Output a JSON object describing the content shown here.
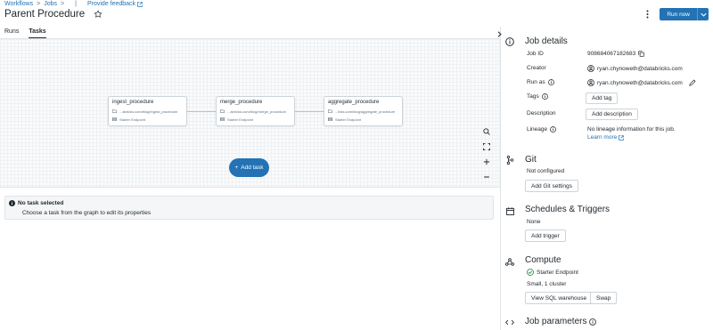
{
  "breadcrumb": {
    "workflows": "Workflows",
    "jobs": "Jobs",
    "separator": ">",
    "divider": "|",
    "feedback": "Provide feedback"
  },
  "header": {
    "title": "Parent Procedure",
    "run_now": "Run now"
  },
  "tabs": [
    {
      "label": "Runs",
      "active": false
    },
    {
      "label": "Tasks",
      "active": true
    }
  ],
  "graph": {
    "tasks": [
      {
        "name": "ingest_procedure",
        "path": "...abricks.com/blog/ingest_procedure",
        "compute": "Starter Endpoint"
      },
      {
        "name": "merge_procedure",
        "path": "...abricks.com/blog/merge_procedure",
        "compute": "Starter Endpoint"
      },
      {
        "name": "aggregate_procedure",
        "path": "...ibks.com/blog/aggregate_procedure",
        "compute": "Starter Endpoint"
      }
    ],
    "add_task": "Add task"
  },
  "task_panel": {
    "title": "No task selected",
    "description": "Choose a task from the graph to edit its properties"
  },
  "job_details": {
    "title": "Job details",
    "job_id_label": "Job ID",
    "job_id": "908684067182683",
    "creator_label": "Creator",
    "creator": "ryan.chynoweth@databricks.com",
    "run_as_label": "Run as",
    "run_as": "ryan.chynoweth@databricks.com",
    "tags_label": "Tags",
    "add_tag": "Add tag",
    "description_label": "Description",
    "add_description": "Add description",
    "lineage_label": "Lineage",
    "lineage_text": "No lineage information for this job.",
    "learn_more": "Learn more"
  },
  "git": {
    "title": "Git",
    "status": "Not configured",
    "button": "Add Git settings"
  },
  "schedules": {
    "title": "Schedules & Triggers",
    "status": "None",
    "button": "Add trigger"
  },
  "compute": {
    "title": "Compute",
    "endpoint": "Starter Endpoint",
    "size": "Small, 1 cluster",
    "view_button": "View SQL warehouse",
    "swap_button": "Swap",
    "status_color": "#277c43"
  },
  "job_parameters": {
    "title": "Job parameters"
  },
  "colors": {
    "accent": "#2272b4",
    "text": "#1f272d",
    "muted": "#5f7281",
    "border": "#cbd4db"
  }
}
